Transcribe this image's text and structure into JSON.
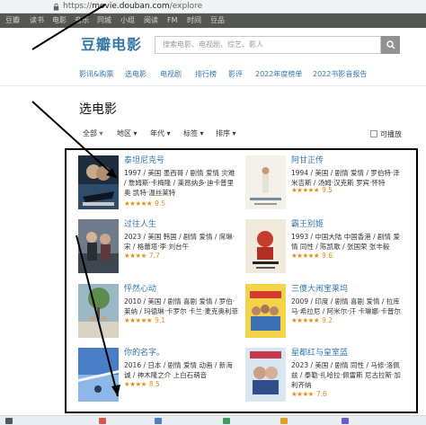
{
  "browser": {
    "url_prefix": "https://",
    "url_host": "movie.douban.com",
    "url_path": "/explore"
  },
  "topnav": [
    "豆瓣",
    "读书",
    "电影",
    "音乐",
    "同城",
    "小组",
    "阅读",
    "FM",
    "时间",
    "豆品"
  ],
  "header": {
    "brand": "豆瓣电影",
    "search_placeholder": "搜索电影、电视剧、综艺、影人"
  },
  "subnav": [
    "影讯&购票",
    "选电影",
    "电视剧",
    "排行榜",
    "影评",
    "2022年度榜单",
    "2022书影音报告"
  ],
  "page_title": "选电影",
  "filters": {
    "items": [
      "全部",
      "地区",
      "年代",
      "标签",
      "排序"
    ],
    "playable_label": "可播放"
  },
  "movies": [
    {
      "title": "泰坦尼克号",
      "meta": "1997 / 美国 墨西哥 / 剧情 爱情 灾难 / 詹姆斯·卡梅隆 / 莱昂纳多·迪卡普里奥 凯特·温丝莱特",
      "stars": "★★★★★",
      "score": "9.5"
    },
    {
      "title": "阿甘正传",
      "meta": "1994 / 美国 / 剧情 爱情 / 罗伯特·泽米吉斯 / 汤姆·汉克斯 罗宾·怀特",
      "stars": "★★★★★",
      "score": "9.5"
    },
    {
      "title": "过往人生",
      "meta": "2023 / 美国 韩国 / 剧情 爱情 / 席琳·宋 / 格蕾塔·李 刘台午",
      "stars": "★★★★",
      "score": "7.7"
    },
    {
      "title": "霸王别姬",
      "meta": "1993 / 中国大陆 中国香港 / 剧情 爱情 同性 / 陈凯歌 / 张国荣 张丰毅",
      "stars": "★★★★★",
      "score": "9.6"
    },
    {
      "title": "怦然心动",
      "meta": "2010 / 美国 / 剧情 喜剧 爱情 / 罗伯·莱纳 / 玛德琳·卡罗尔 卡兰·麦克奥利菲",
      "stars": "★★★★★",
      "score": "9.1"
    },
    {
      "title": "三傻大闹宝莱坞",
      "meta": "2009 / 印度 / 剧情 喜剧 爱情 / 拉库马·希拉尼 / 阿米尔·汗 卡琳娜·卡普尔",
      "stars": "★★★★★",
      "score": "9.2"
    },
    {
      "title": "你的名字。",
      "meta": "2016 / 日本 / 剧情 爱情 动画 / 新海诚 / 神木隆之介 上白石萌音",
      "stars": "★★★★",
      "score": "8.5"
    },
    {
      "title": "星都红与皇室蓝",
      "meta": "2023 / 美国 / 剧情 同性 / 马修·洛佩兹 / 泰勒·扎哈拉·佩雷斯 尼古拉斯·加利齐纳",
      "stars": "★★★★",
      "score": "7.6"
    }
  ],
  "colors": {
    "link": "#3377aa",
    "topnav_bg": "#545652",
    "star": "#e09015"
  },
  "icons": [
    "lock-icon",
    "search-icon"
  ]
}
